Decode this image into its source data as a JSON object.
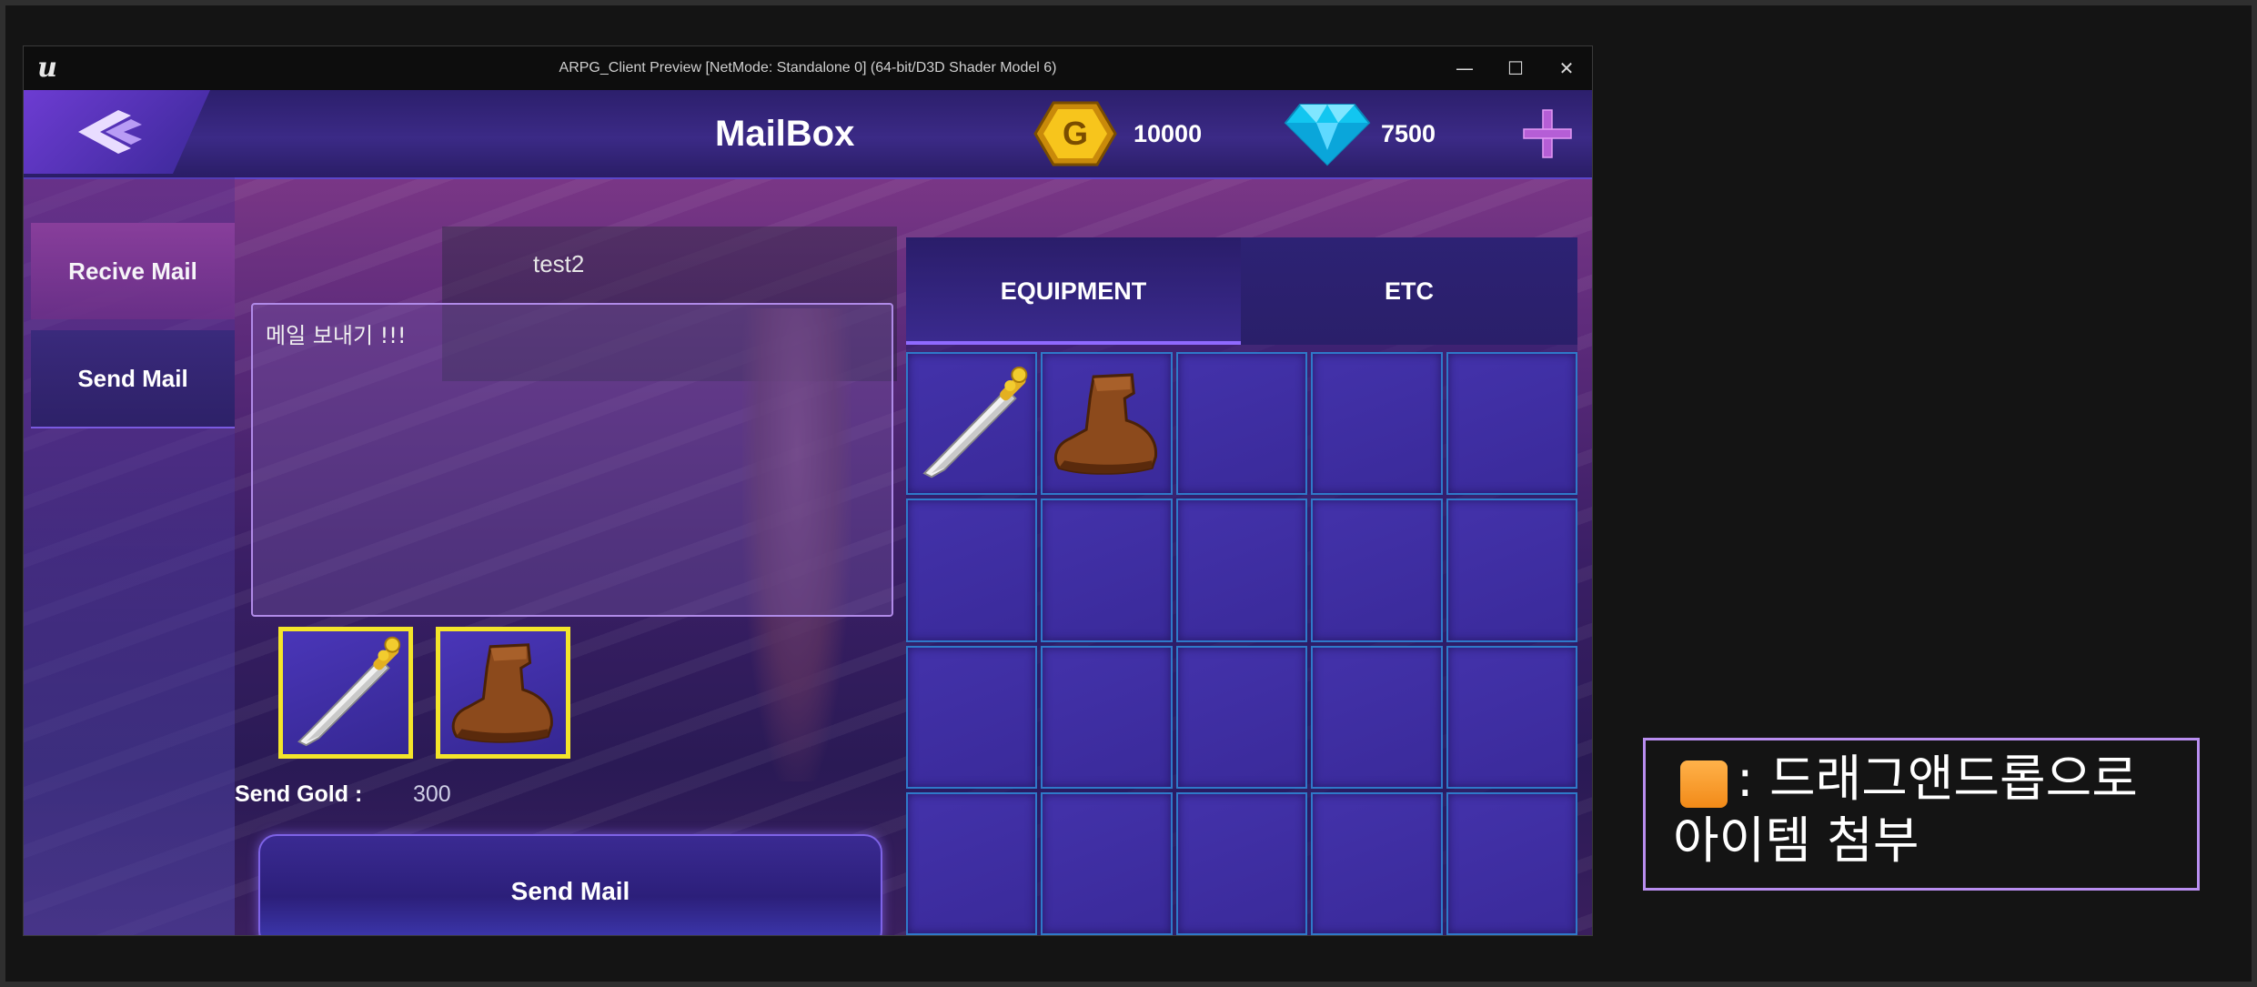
{
  "window": {
    "title": "ARPG_Client Preview [NetMode: Standalone 0]  (64-bit/D3D Shader Model 6)",
    "minimize_glyph": "—",
    "maximize_glyph": "☐",
    "close_glyph": "✕",
    "logo_glyph": "u"
  },
  "header": {
    "title": "MailBox",
    "gold": {
      "value": "10000",
      "icon": "gold-coin-icon",
      "letter": "G"
    },
    "diamond": {
      "value": "7500",
      "icon": "diamond-icon"
    },
    "add_icon": "plus-icon"
  },
  "sidebar": {
    "items": [
      {
        "label": "Recive Mail"
      },
      {
        "label": "Send Mail"
      }
    ]
  },
  "compose": {
    "recipient": "test2",
    "message": "메일 보내기 !!!",
    "attachments": [
      {
        "item": "sword",
        "icon": "sword-icon"
      },
      {
        "item": "boots",
        "icon": "boots-icon"
      }
    ],
    "send_gold_label": "Send Gold :",
    "send_gold_value": "300",
    "send_button_label": "Send Mail"
  },
  "inventory": {
    "tabs": [
      {
        "label": "EQUIPMENT",
        "active": true
      },
      {
        "label": "ETC",
        "active": false
      }
    ],
    "rows": 4,
    "cols": 5,
    "items": [
      "sword",
      "boots",
      "",
      "",
      "",
      "",
      "",
      "",
      "",
      "",
      "",
      "",
      "",
      "",
      "",
      "",
      "",
      "",
      "",
      ""
    ]
  },
  "annotation": {
    "text": ": 드래그앤드롭으로 아이템 첨부",
    "swatch_color": "#f7a030"
  },
  "colors": {
    "accent": "#5d46c9",
    "attachment_highlight": "#f4e52a",
    "slot_border": "#2f79c9"
  }
}
